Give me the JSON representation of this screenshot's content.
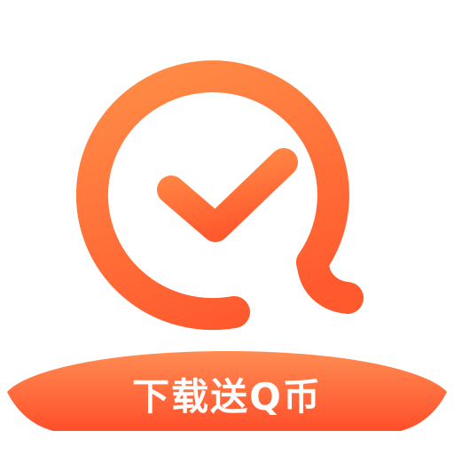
{
  "icon": {
    "semantic": "check-q-logo-icon",
    "accent_light": "#FF8A45",
    "accent_dark": "#FF5A2E",
    "banner_light": "#FF8C52",
    "banner_dark": "#FF4F2A"
  },
  "banner": {
    "text": "下载送Q币"
  }
}
